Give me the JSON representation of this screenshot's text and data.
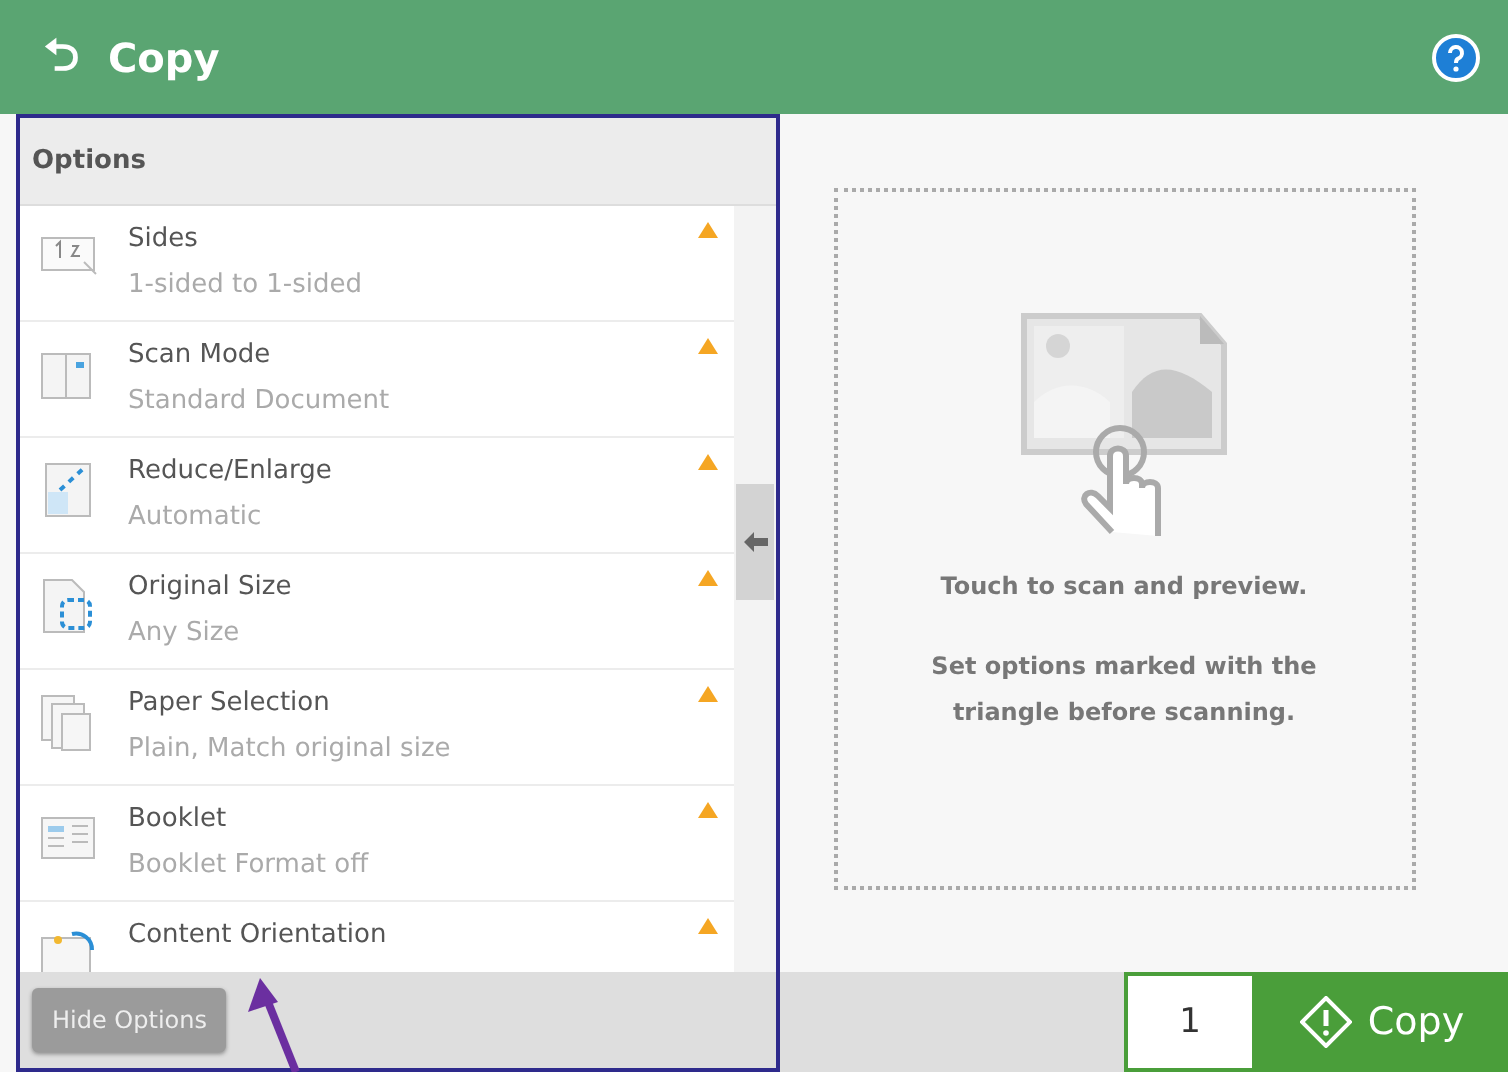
{
  "header": {
    "title": "Copy",
    "back_icon": "⮌"
  },
  "options": {
    "heading": "Options",
    "items": [
      {
        "kind": "sides",
        "title": "Sides",
        "subtitle": "1-sided to 1-sided",
        "marked": true
      },
      {
        "kind": "scan",
        "title": "Scan Mode",
        "subtitle": "Standard Document",
        "marked": true
      },
      {
        "kind": "reduce",
        "title": "Reduce/Enlarge",
        "subtitle": "Automatic",
        "marked": true
      },
      {
        "kind": "size",
        "title": "Original Size",
        "subtitle": "Any Size",
        "marked": true
      },
      {
        "kind": "paper",
        "title": "Paper Selection",
        "subtitle": "Plain, Match original size",
        "marked": true
      },
      {
        "kind": "booklet",
        "title": "Booklet",
        "subtitle": "Booklet Format off",
        "marked": true
      },
      {
        "kind": "orientation",
        "title": "Content Orientation",
        "marked": true
      }
    ],
    "hide_button": "Hide Options"
  },
  "preview": {
    "hint": "Touch to scan and preview.",
    "note": "Set options marked with the triangle before scanning."
  },
  "copies": "1",
  "copy_button": "Copy"
}
